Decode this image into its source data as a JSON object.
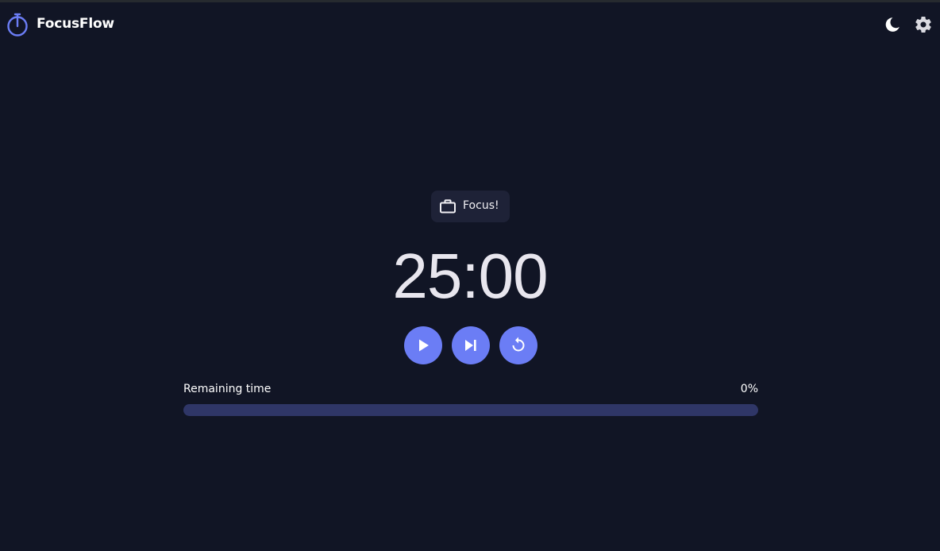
{
  "app": {
    "title": "FocusFlow"
  },
  "header": {
    "icons": [
      "stopwatch-icon",
      "moon-icon",
      "gear-icon"
    ]
  },
  "mode": {
    "label": "Focus!",
    "icon": "briefcase-icon"
  },
  "timer": {
    "display": "25:00"
  },
  "controls": {
    "icons": [
      "play-icon",
      "skip-next-icon",
      "reset-icon"
    ]
  },
  "progress": {
    "label": "Remaining time",
    "value_text": "0%",
    "value": 0
  },
  "colors": {
    "background": "#111525",
    "accent": "#6b7df5",
    "track": "#2f3667",
    "pill": "#1e2237"
  }
}
